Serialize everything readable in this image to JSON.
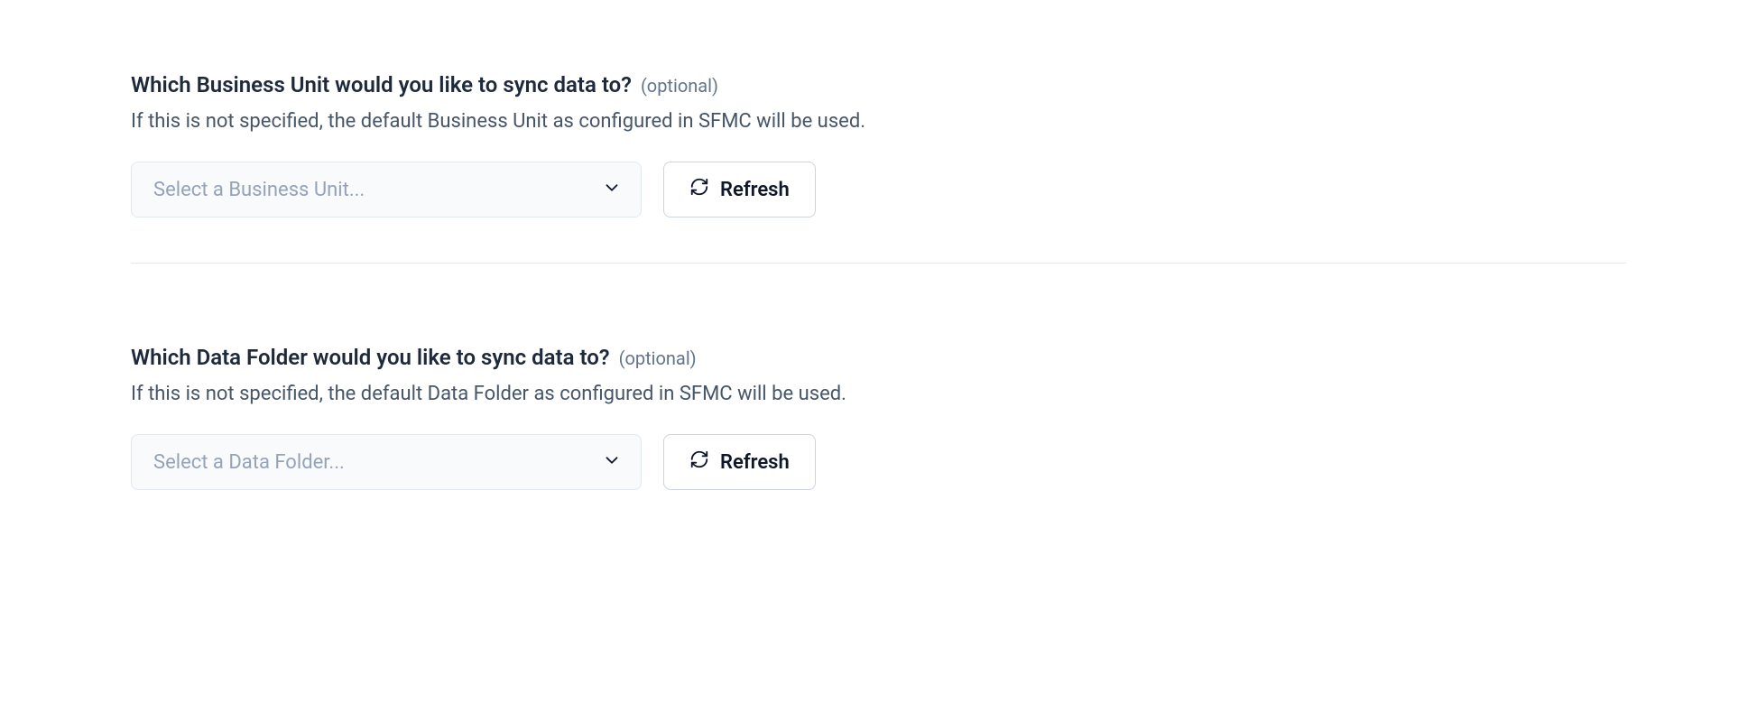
{
  "sections": {
    "businessUnit": {
      "title": "Which Business Unit would you like to sync data to?",
      "optionalTag": "(optional)",
      "description": "If this is not specified, the default Business Unit as configured in SFMC will be used.",
      "placeholder": "Select a Business Unit...",
      "refreshLabel": "Refresh"
    },
    "dataFolder": {
      "title": "Which Data Folder would you like to sync data to?",
      "optionalTag": "(optional)",
      "description": "If this is not specified, the default Data Folder as configured in SFMC will be used.",
      "placeholder": "Select a Data Folder...",
      "refreshLabel": "Refresh"
    }
  }
}
